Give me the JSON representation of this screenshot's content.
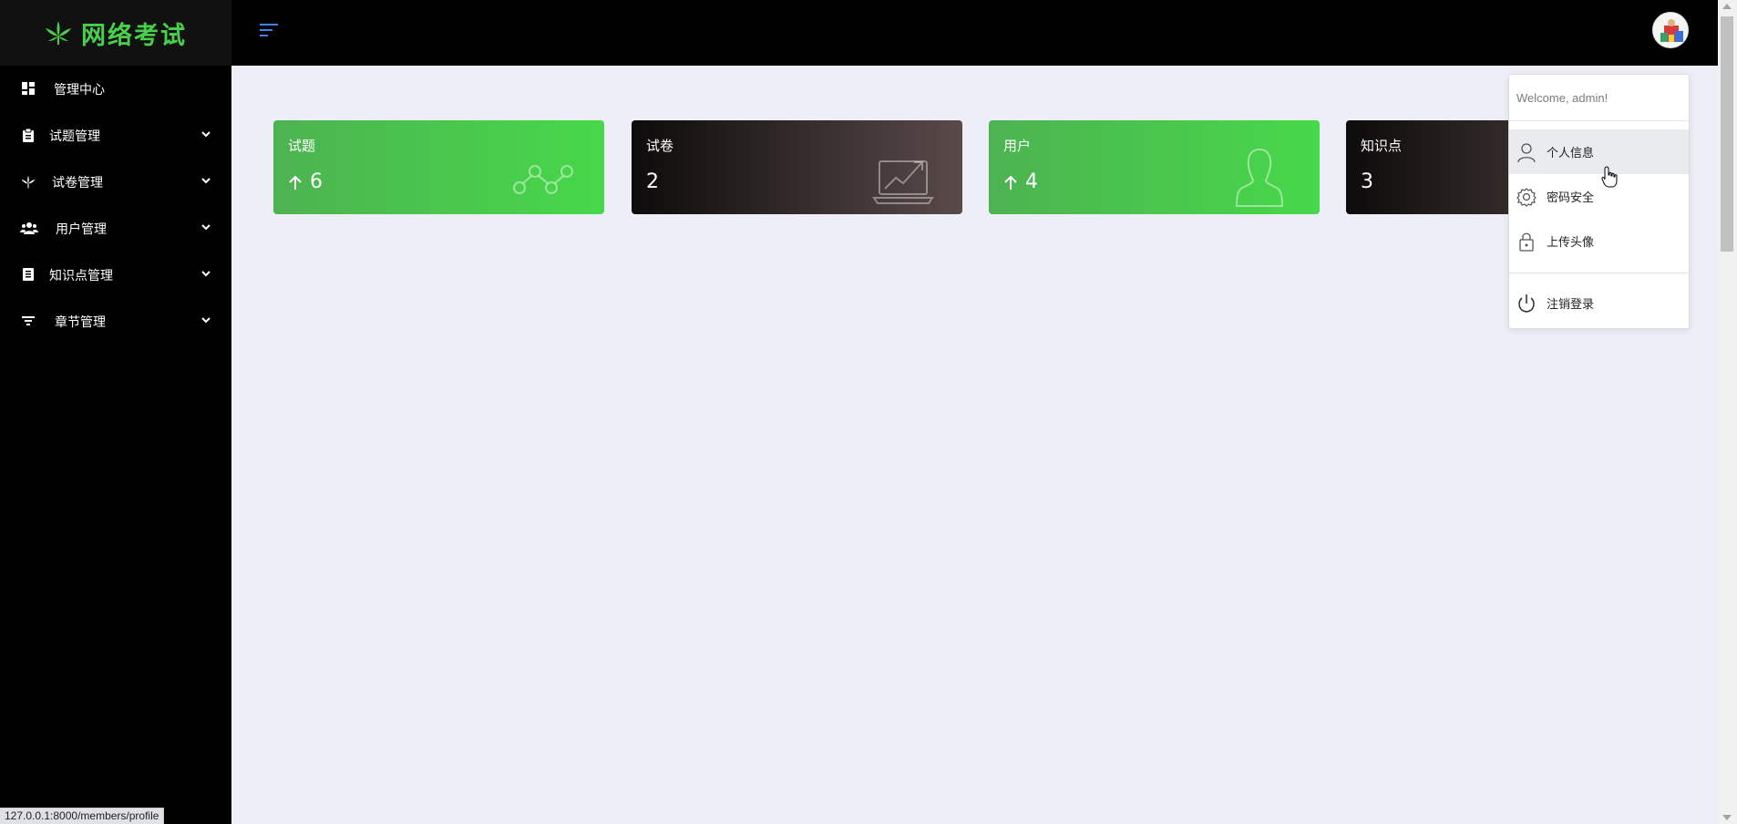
{
  "brand": {
    "title": "网络考试",
    "color": "#49d04a"
  },
  "sidebar": {
    "items": [
      {
        "label": "管理中心",
        "icon": "dashboard-icon",
        "has_caret": false
      },
      {
        "label": "试题管理",
        "icon": "clipboard-icon",
        "has_caret": true
      },
      {
        "label": "试卷管理",
        "icon": "leaf-icon",
        "has_caret": true
      },
      {
        "label": "用户管理",
        "icon": "users-icon",
        "has_caret": true
      },
      {
        "label": "知识点管理",
        "icon": "book-icon",
        "has_caret": true
      },
      {
        "label": "章节管理",
        "icon": "filter-icon",
        "has_caret": true
      }
    ]
  },
  "cards": [
    {
      "title": "试题",
      "value": "6",
      "trend": "up",
      "style": "green",
      "art": "line-graph-icon"
    },
    {
      "title": "试卷",
      "value": "2",
      "trend": "",
      "style": "dark",
      "art": "laptop-chart-icon"
    },
    {
      "title": "用户",
      "value": "4",
      "trend": "up",
      "style": "green",
      "art": "user-silhouette-icon"
    },
    {
      "title": "知识点",
      "value": "3",
      "trend": "",
      "style": "dark",
      "art": ""
    }
  ],
  "user_menu": {
    "welcome": "Welcome, admin!",
    "items": [
      {
        "label": "个人信息",
        "icon": "user-icon"
      },
      {
        "label": "密码安全",
        "icon": "gear-icon"
      },
      {
        "label": "上传头像",
        "icon": "lock-icon"
      }
    ],
    "logout": {
      "label": "注销登录",
      "icon": "power-icon"
    }
  },
  "status_bar": {
    "url": "127.0.0.1:8000/members/profile"
  },
  "colors": {
    "green_start": "#4cb350",
    "green_end": "#47d84a",
    "dark_start": "#0d0b0b",
    "dark_end": "#5a4a4a",
    "accent_blue": "#3b82f6"
  }
}
